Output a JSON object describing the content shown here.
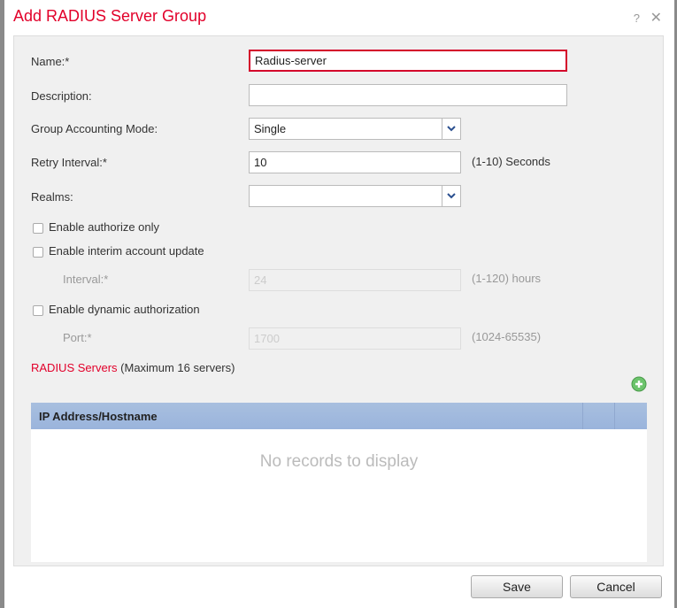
{
  "dialog": {
    "title": "Add RADIUS Server Group",
    "help_label": "?",
    "close_label": "✕"
  },
  "form": {
    "name_label": "Name:*",
    "name_value": "Radius-server",
    "description_label": "Description:",
    "description_value": "",
    "accounting_label": "Group Accounting Mode:",
    "accounting_value": "Single",
    "retry_label": "Retry Interval:*",
    "retry_value": "10",
    "retry_hint": "(1-10) Seconds",
    "realms_label": "Realms:",
    "realms_value": "",
    "authorize_only_label": "Enable authorize only",
    "authorize_only_checked": false,
    "interim_label": "Enable interim account update",
    "interim_checked": false,
    "interval_label": "Interval:*",
    "interval_value": "24",
    "interval_hint": "(1-120) hours",
    "dynamic_label": "Enable dynamic authorization",
    "dynamic_checked": false,
    "port_label": "Port:*",
    "port_value": "1700",
    "port_hint": "(1024-65535)"
  },
  "servers": {
    "title": "RADIUS Servers",
    "subtitle": "(Maximum 16 servers)",
    "add_icon": "plus-circle-icon",
    "columns": [
      "IP Address/Hostname"
    ],
    "empty_text": "No records to display"
  },
  "buttons": {
    "save": "Save",
    "cancel": "Cancel"
  },
  "colors": {
    "accent": "#e2002a",
    "table_header": "#a8bfdf",
    "add_icon": "#5cb85c"
  }
}
